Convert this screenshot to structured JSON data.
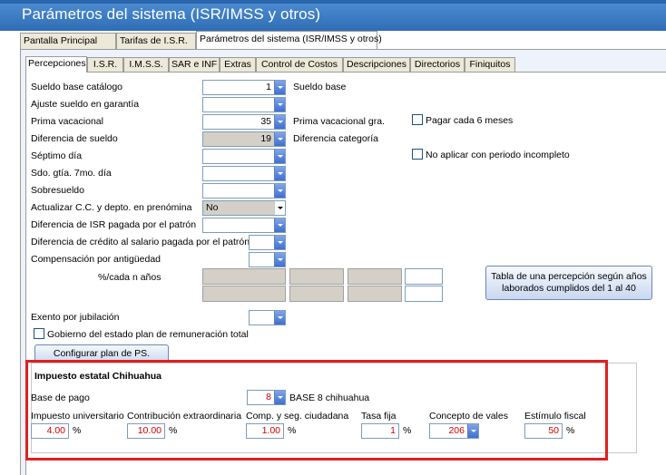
{
  "window": {
    "title": "Parámetros del sistema (ISR/IMSS y otros)"
  },
  "main_tabs": [
    {
      "label": "Pantalla Principal"
    },
    {
      "label": "Tarifas de I.S.R."
    },
    {
      "label": "Parámetros del sistema (ISR/IMSS y otros)"
    }
  ],
  "sub_tabs": [
    {
      "label": "Percepciones"
    },
    {
      "label": "I.S.R."
    },
    {
      "label": "I.M.S.S."
    },
    {
      "label": "SAR e INF"
    },
    {
      "label": "Extras"
    },
    {
      "label": "Control de Costos"
    },
    {
      "label": "Descripciones"
    },
    {
      "label": "Directorios"
    },
    {
      "label": "Finiquitos"
    }
  ],
  "percepciones": {
    "sueldo_base_catalogo": {
      "label": "Sueldo base catálogo",
      "value": "1",
      "desc": "Sueldo base"
    },
    "ajuste_sueldo": {
      "label": "Ajuste sueldo en garantía",
      "value": ""
    },
    "prima_vacacional": {
      "label": "Prima vacacional",
      "value": "35",
      "desc": "Prima vacacional gra.",
      "checkbox": "Pagar cada 6 meses"
    },
    "diferencia_sueldo": {
      "label": "Diferencia de sueldo",
      "value": "19",
      "desc": "Diferencia categoría"
    },
    "septimo_dia": {
      "label": "Séptimo día",
      "value": "",
      "checkbox": "No aplicar con periodo incompleto"
    },
    "sdo_gtia": {
      "label": "Sdo. gtía. 7mo. día",
      "value": ""
    },
    "sobresueldo": {
      "label": "Sobresueldo",
      "value": ""
    },
    "actualizar_cc": {
      "label": "Actualizar C.C. y depto. en prenómina",
      "value": "No"
    },
    "dif_isr": {
      "label": "Diferencia de ISR pagada por el patrón",
      "value": ""
    },
    "dif_credito": {
      "label": "Diferencia de crédito al salario pagada por el patrón",
      "value": ""
    },
    "comp_antiguedad": {
      "label": "Compensación por antigüedad",
      "value": ""
    },
    "pct_cada_n": {
      "label": "%/cada n años"
    },
    "tabla_button": {
      "label": "Tabla de una percepción según años laborados cumplidos del 1 al 40"
    },
    "exento_jubilacion": {
      "label": "Exento por jubilación",
      "value": ""
    },
    "gobierno_checkbox": {
      "label": "Gobierno del estado plan de remuneración total"
    },
    "configurar_ps": {
      "label": "Configurar plan de PS."
    }
  },
  "chihuahua": {
    "title": "Impuesto estatal Chihuahua",
    "base_pago": {
      "label": "Base de pago",
      "value": "8",
      "desc": "BASE 8 chihuahua"
    },
    "fields": [
      {
        "label": "Impuesto universitario",
        "value": "4.00",
        "unit": "%"
      },
      {
        "label": "Contribución extraordinaria",
        "value": "10.00",
        "unit": "%"
      },
      {
        "label": "Comp. y seg. ciudadana",
        "value": "1.00",
        "unit": "%"
      },
      {
        "label": "Tasa fija",
        "value": "1",
        "unit": "%"
      },
      {
        "label": "Concepto de vales",
        "value": "206"
      },
      {
        "label": "Estímulo fiscal",
        "value": "50",
        "unit": "%"
      }
    ]
  },
  "colors": {
    "title_bar": "#3a78c2",
    "highlight_box": "#e02020",
    "value_red": "#d40000"
  }
}
